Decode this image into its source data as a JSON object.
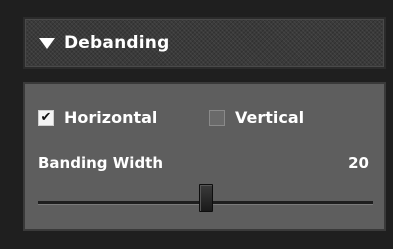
{
  "section": {
    "title": "Debanding",
    "expanded": true
  },
  "options": {
    "horizontal": {
      "label": "Horizontal",
      "checked": true
    },
    "vertical": {
      "label": "Vertical",
      "checked": false
    }
  },
  "banding_width": {
    "label": "Banding Width",
    "value": "20",
    "slider_fraction": 0.5
  },
  "colors": {
    "panel_bg": "#5e5e5e",
    "header_bg": "#3a3a3a",
    "text": "#ffffff"
  },
  "icons": {
    "disclosure": "triangle-down-icon",
    "checkmark": "checkmark-icon"
  }
}
